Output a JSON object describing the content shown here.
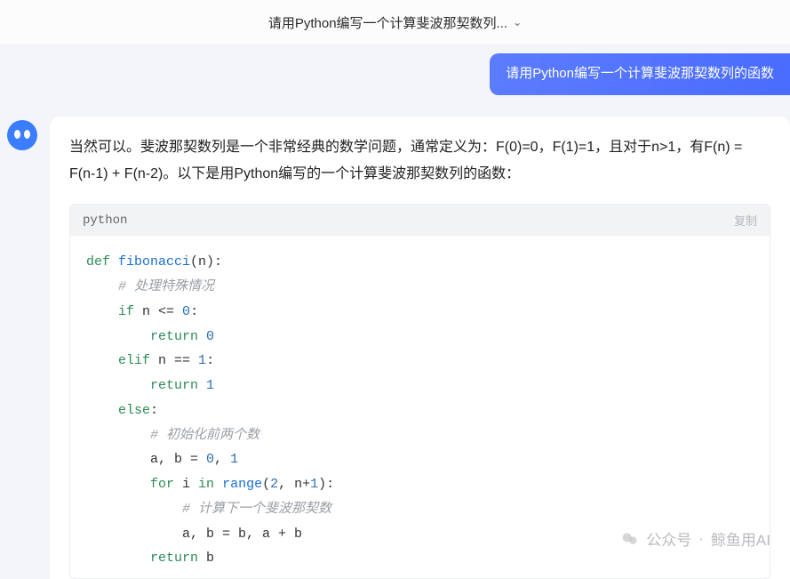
{
  "topbar": {
    "title": "请用Python编写一个计算斐波那契数列..."
  },
  "user_message": "请用Python编写一个计算斐波那契数列的函数",
  "assistant": {
    "intro": "当然可以。斐波那契数列是一个非常经典的数学问题，通常定义为：F(0)=0，F(1)=1，且对于n>1，有F(n) = F(n-1) + F(n-2)。以下是用Python编写的一个计算斐波那契数列的函数：",
    "code": {
      "language": "python",
      "copy_label": "复制",
      "lines": [
        {
          "t": "keyword",
          "v": "def"
        },
        {
          "v": " "
        },
        {
          "t": "fn",
          "v": "fibonacci"
        },
        {
          "v": "(n):"
        }
      ],
      "raw_lines": [
        "def fibonacci(n):",
        "    # 处理特殊情况",
        "    if n <= 0:",
        "        return 0",
        "    elif n == 1:",
        "        return 1",
        "    else:",
        "        # 初始化前两个数",
        "        a, b = 0, 1",
        "        for i in range(2, n+1):",
        "            # 计算下一个斐波那契数",
        "            a, b = b, a + b",
        "        return b"
      ]
    }
  },
  "watermark": {
    "prefix": "公众号",
    "sep": "·",
    "name": "鲸鱼用AI"
  }
}
